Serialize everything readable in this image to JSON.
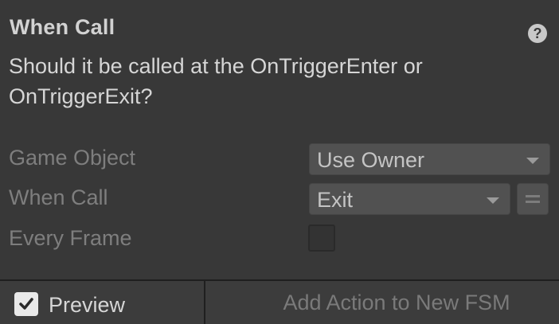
{
  "header": {
    "title": "When Call",
    "help_icon": "question-mark-icon",
    "description": "Should it be called at the OnTriggerEnter or OnTriggerExit?"
  },
  "fields": {
    "game_object": {
      "label": "Game Object",
      "value": "Use Owner"
    },
    "when_call": {
      "label": "When Call",
      "value": "Exit"
    },
    "every_frame": {
      "label": "Every Frame",
      "checked": false
    }
  },
  "footer": {
    "preview_label": "Preview",
    "preview_checked": true,
    "add_action_label": "Add Action to New FSM"
  },
  "colors": {
    "panel_bg": "#383838",
    "field_bg": "#515151",
    "label_disabled": "#7e7e7e",
    "text": "#d6d6d6"
  }
}
